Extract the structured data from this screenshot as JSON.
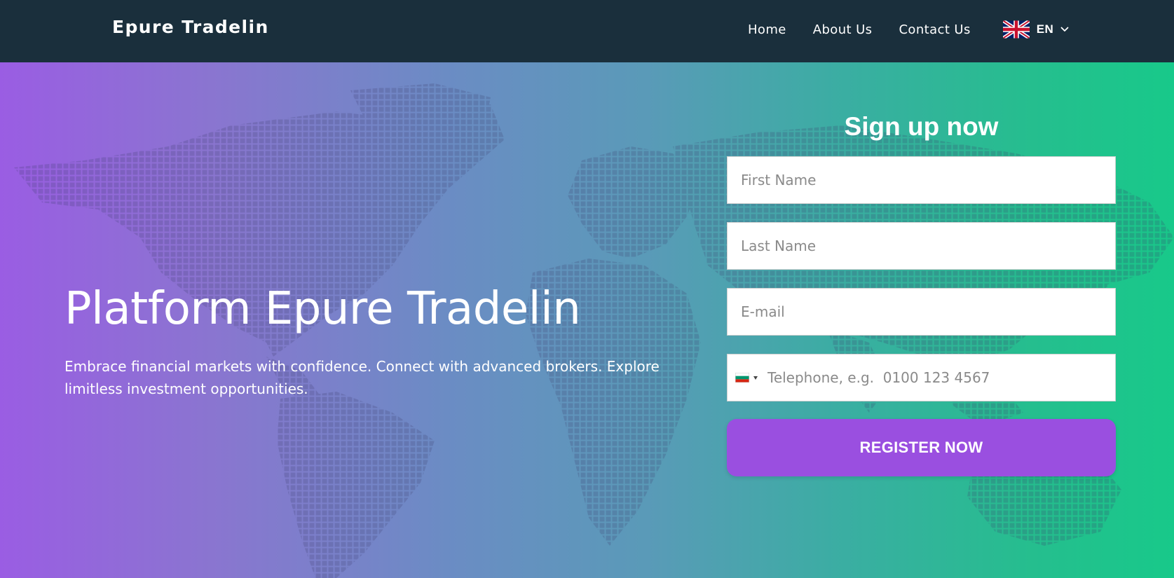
{
  "header": {
    "brand": "Epure Tradelin",
    "nav": {
      "home": "Home",
      "about": "About Us",
      "contact": "Contact Us"
    },
    "language": {
      "code": "EN",
      "flag": "uk-flag-icon"
    }
  },
  "hero": {
    "title": "Platform Epure Tradelin",
    "subtitle": "Embrace financial markets with confidence. Connect with advanced brokers. Explore limitless investment opportunities."
  },
  "signup": {
    "title": "Sign up now",
    "first_name_placeholder": "First Name",
    "last_name_placeholder": "Last Name",
    "email_placeholder": "E-mail",
    "telephone_placeholder": "Telephone, e.g.  0100 123 4567",
    "country_flag": "bulgaria-flag-icon",
    "register_label": "REGISTER NOW"
  },
  "colors": {
    "header_bg": "#1a2f3c",
    "gradient_start": "#9a5de3",
    "gradient_end": "#18c98a",
    "button_bg": "#9a4fe0"
  }
}
